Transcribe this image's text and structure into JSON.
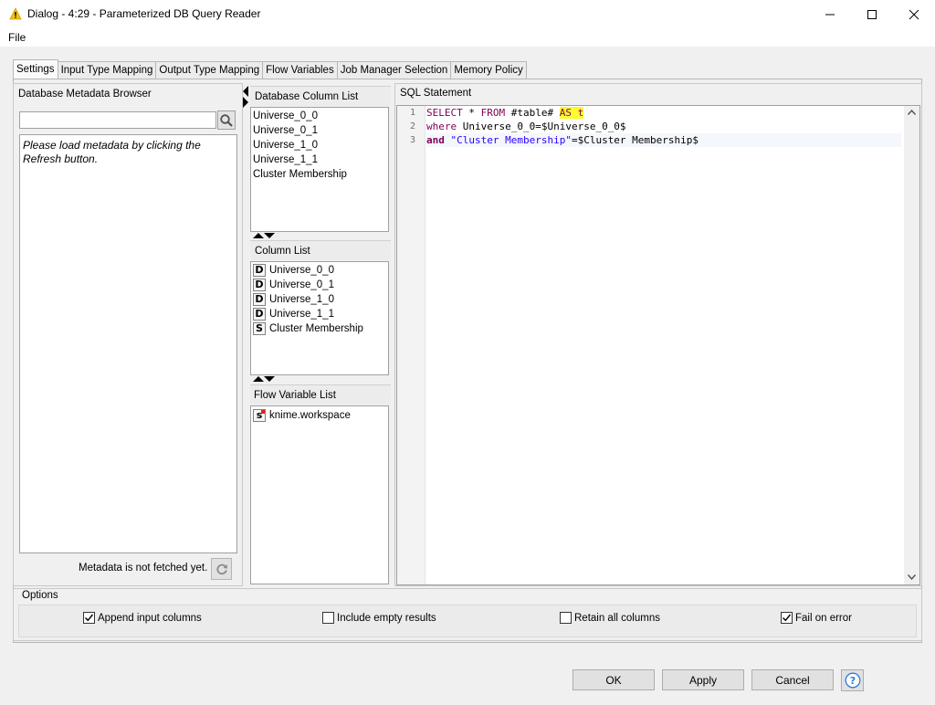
{
  "window": {
    "title": "Dialog - 4:29 - Parameterized DB Query Reader",
    "menu": [
      "File"
    ]
  },
  "tabs": [
    {
      "label": "Settings",
      "active": true
    },
    {
      "label": "Input Type Mapping"
    },
    {
      "label": "Output Type Mapping"
    },
    {
      "label": "Flow Variables"
    },
    {
      "label": "Job Manager Selection"
    },
    {
      "label": "Memory Policy"
    }
  ],
  "metadata_browser": {
    "title": "Database Metadata Browser",
    "search_value": "",
    "message": "Please load metadata by clicking the Refresh button.",
    "status": "Metadata is not fetched yet.",
    "icons": {
      "search": "search-icon",
      "refresh": "refresh-icon"
    }
  },
  "db_column_list": {
    "title": "Database Column List",
    "items": [
      "Universe_0_0",
      "Universe_0_1",
      "Universe_1_0",
      "Universe_1_1",
      "Cluster Membership"
    ]
  },
  "column_list": {
    "title": "Column List",
    "items": [
      {
        "type": "D",
        "label": "Universe_0_0"
      },
      {
        "type": "D",
        "label": "Universe_0_1"
      },
      {
        "type": "D",
        "label": "Universe_1_0"
      },
      {
        "type": "D",
        "label": "Universe_1_1"
      },
      {
        "type": "S",
        "label": "Cluster Membership"
      }
    ]
  },
  "flow_variable_list": {
    "title": "Flow Variable List",
    "items": [
      {
        "type": "s",
        "label": "knime.workspace"
      }
    ]
  },
  "sql": {
    "title": "SQL Statement",
    "lines": [
      {
        "num": "1",
        "kw1": "SELECT",
        "t1": " * ",
        "kw2": "FROM",
        "t2": " #table# ",
        "hl": "AS t"
      },
      {
        "num": "2",
        "kw1": "where",
        "t1": " Universe_0_0=$Universe_0_0$"
      },
      {
        "num": "3",
        "kw1": "and",
        "t1": " ",
        "str": "\"Cluster Membership\"",
        "t2": "=$Cluster Membership$"
      }
    ]
  },
  "options": {
    "title": "Options",
    "checkboxes": [
      {
        "label": "Append input columns",
        "checked": true
      },
      {
        "label": "Include empty results",
        "checked": false
      },
      {
        "label": "Retain all columns",
        "checked": false
      },
      {
        "label": "Fail on error",
        "checked": true
      }
    ]
  },
  "buttons": {
    "ok": "OK",
    "apply": "Apply",
    "cancel": "Cancel",
    "help": "?"
  }
}
